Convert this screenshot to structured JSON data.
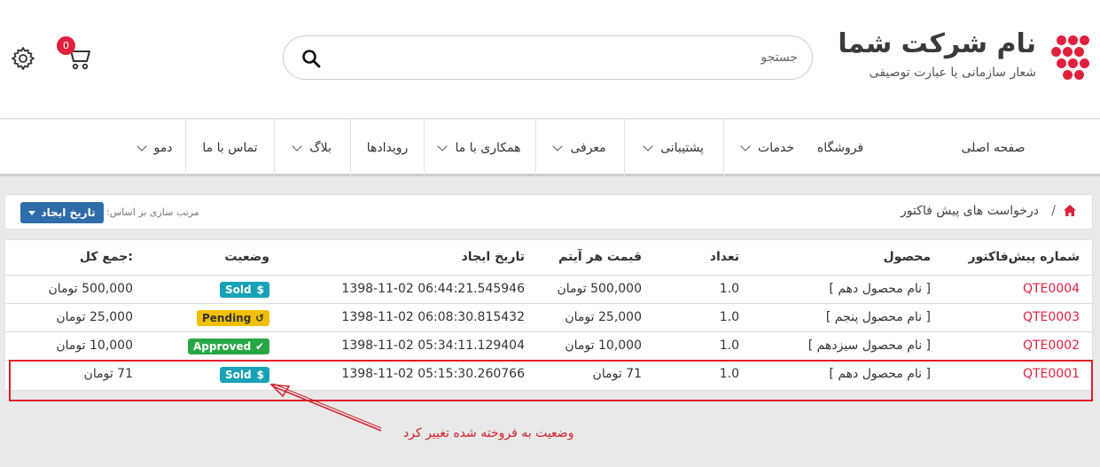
{
  "header": {
    "logo_title": "نام شرکت شما",
    "logo_subtitle": "شعار سازمانی یا عبارت توصیفی",
    "search_placeholder": "جستجو",
    "cart_count": "0"
  },
  "nav": {
    "items": [
      {
        "label": "صفحه اصلی",
        "dropdown": false
      },
      {
        "label": "فروشگاه",
        "dropdown": false
      },
      {
        "label": "خدمات",
        "dropdown": true
      },
      {
        "label": "پشتیبانی",
        "dropdown": true
      },
      {
        "label": "معرفی",
        "dropdown": true
      },
      {
        "label": "همکاری با ما",
        "dropdown": true
      },
      {
        "label": "رویدادها",
        "dropdown": false
      },
      {
        "label": "بلاگ",
        "dropdown": true
      },
      {
        "label": "تماس با ما",
        "dropdown": false
      },
      {
        "label": "دمو",
        "dropdown": true
      }
    ]
  },
  "breadcrumb": {
    "separator": "/",
    "current": "درخواست های پیش فاکتور"
  },
  "sort": {
    "label": "مرتب سازی بر اساس:",
    "value": "تاریخ ایجاد"
  },
  "table": {
    "headers": {
      "number": "شماره پیش‌فاکتور",
      "product": "محصول",
      "qty": "تعداد",
      "unit_price": "قیمت هر آیتم",
      "created": "تاریخ ایجاد",
      "status": "وضعیت",
      "total": "جمع کل:"
    },
    "rows": [
      {
        "number": "QTE0004",
        "product": "[ نام محصول دهم ]",
        "qty": "1.0",
        "unit_price": "500,000 تومان",
        "created": "1398-11-02 06:44:21.545946",
        "status": "Sold",
        "total": "500,000 تومان"
      },
      {
        "number": "QTE0003",
        "product": "[ نام محصول پنجم ]",
        "qty": "1.0",
        "unit_price": "25,000 تومان",
        "created": "1398-11-02 06:08:30.815432",
        "status": "Pending",
        "total": "25,000 تومان"
      },
      {
        "number": "QTE0002",
        "product": "[ نام محصول سیزدهم ]",
        "qty": "1.0",
        "unit_price": "10,000 تومان",
        "created": "1398-11-02 05:34:11.129404",
        "status": "Approved",
        "total": "10,000 تومان"
      },
      {
        "number": "QTE0001",
        "product": "[ نام محصول دهم ]",
        "qty": "1.0",
        "unit_price": "71 تومان",
        "created": "1398-11-02 05:15:30.260766",
        "status": "Sold",
        "total": "71 تومان"
      }
    ]
  },
  "annotation": {
    "note": "وضعیت به فروخته شده تغییر کرد"
  },
  "colors": {
    "brand": "#e0213d",
    "sold": "#17a2b8",
    "pending": "#f0c000",
    "approved": "#28a745",
    "sort_button": "#2f6caa",
    "annotation": "#e0202a"
  }
}
